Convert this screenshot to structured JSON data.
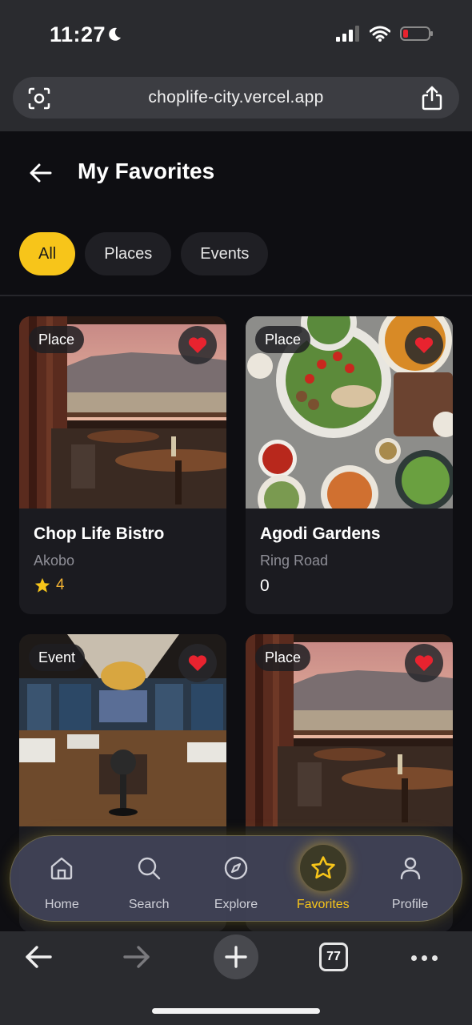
{
  "status_bar": {
    "time": "11:27"
  },
  "browser": {
    "url": "choplife-city.vercel.app",
    "tab_count": "77"
  },
  "page": {
    "title": "My Favorites"
  },
  "filters": [
    {
      "label": "All",
      "active": true
    },
    {
      "label": "Places",
      "active": false
    },
    {
      "label": "Events",
      "active": false
    }
  ],
  "cards": [
    {
      "badge": "Place",
      "title": "Chop Life Bistro",
      "location": "Akobo",
      "rating": "4"
    },
    {
      "badge": "Place",
      "title": "Agodi Gardens",
      "location": "Ring Road",
      "rating": "0"
    },
    {
      "badge": "Event"
    },
    {
      "badge": "Place"
    }
  ],
  "nav": {
    "items": [
      {
        "label": "Home",
        "icon": "home-icon"
      },
      {
        "label": "Search",
        "icon": "search-icon"
      },
      {
        "label": "Explore",
        "icon": "compass-icon"
      },
      {
        "label": "Favorites",
        "icon": "star-icon",
        "active": true
      },
      {
        "label": "Profile",
        "icon": "user-icon"
      }
    ]
  },
  "colors": {
    "accent": "#f7c51a",
    "heart": "#e8232f",
    "background": "#0e0e12",
    "card": "#1b1b20"
  }
}
